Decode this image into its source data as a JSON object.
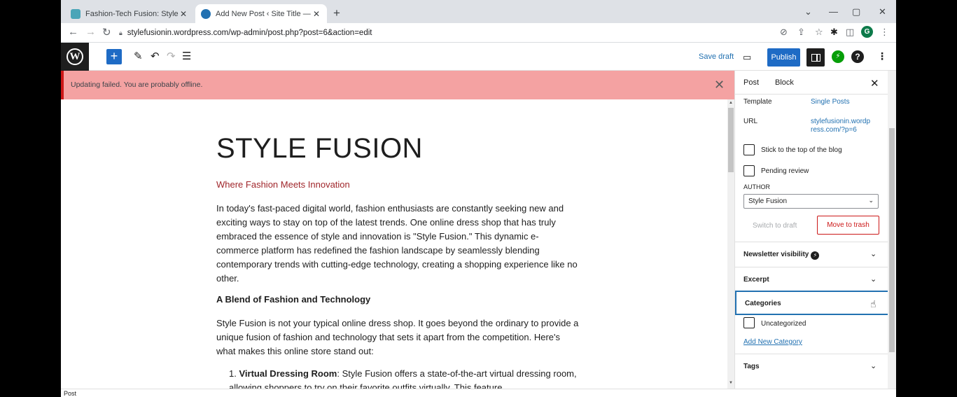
{
  "browser": {
    "tabs": [
      {
        "label": "Fashion-Tech Fusion: Style Revol",
        "active": false,
        "favicon_color": "#4aa5b8"
      },
      {
        "label": "Add New Post ‹ Site Title — Wor",
        "active": true,
        "favicon_color": "#2271b1"
      }
    ],
    "url": "stylefusionin.wordpress.com/wp-admin/post.php?post=6&action=edit",
    "profile_initial": "G"
  },
  "toolbar": {
    "save_draft": "Save draft",
    "publish": "Publish"
  },
  "notice": {
    "text": "Updating failed. You are probably offline."
  },
  "post": {
    "title": "STYLE FUSION",
    "subtitle": "Where Fashion Meets Innovation",
    "paragraph1": "In today's fast-paced digital world, fashion enthusiasts are constantly seeking new and exciting ways to stay on top of the latest trends. One online dress shop that has truly embraced the essence of style and innovation is \"Style Fusion.\" This dynamic e-commerce platform has redefined the fashion landscape by seamlessly blending contemporary trends with cutting-edge technology, creating a shopping experience like no other.",
    "heading1": "A Blend of Fashion and Technology",
    "paragraph2": "Style Fusion is not your typical online dress shop. It goes beyond the ordinary to provide a unique fusion of fashion and technology that sets it apart from the competition. Here's what makes this online store stand out:",
    "list_item1_number": "1.",
    "list_item1_bold": "Virtual Dressing Room",
    "list_item1_text": ": Style Fusion offers a state-of-the-art virtual dressing room, allowing shoppers to try on their favorite outfits virtually. This feature"
  },
  "sidebar": {
    "tab_post": "Post",
    "tab_block": "Block",
    "template_label": "Template",
    "template_value": "Single Posts",
    "url_label": "URL",
    "url_value_line1": "stylefusionin.wordp",
    "url_value_line2": "ress.com/?p=6",
    "sticky_label": "Stick to the top of the blog",
    "pending_label": "Pending review",
    "author_label": "AUTHOR",
    "author_value": "Style Fusion",
    "switch_to_draft": "Switch to draft",
    "move_to_trash": "Move to trash",
    "panels": {
      "newsletter": "Newsletter visibility",
      "excerpt": "Excerpt",
      "categories": "Categories",
      "tags": "Tags"
    },
    "category_uncategorized": "Uncategorized",
    "add_new_category": "Add New Category"
  },
  "footer": {
    "breadcrumb": "Post"
  }
}
